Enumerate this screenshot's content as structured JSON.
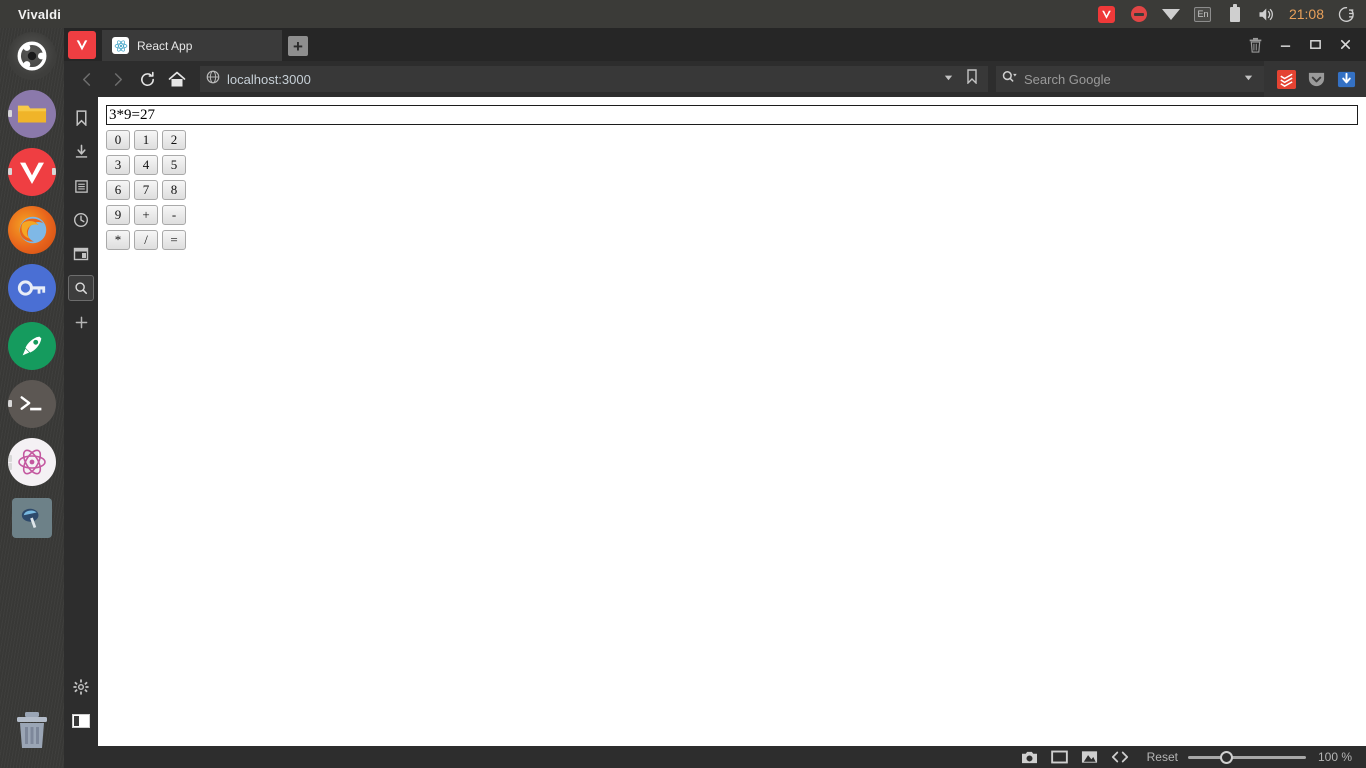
{
  "desktop": {
    "panel_title": "Vivaldi",
    "clock": "21:08",
    "tray": [
      {
        "name": "vivaldi-tray-icon",
        "label": "Vivaldi"
      },
      {
        "name": "do-not-disturb-icon",
        "label": "Do Not Disturb"
      },
      {
        "name": "wifi-icon",
        "label": "Network"
      },
      {
        "name": "keyboard-layout-icon",
        "label": "En"
      },
      {
        "name": "battery-icon",
        "label": "Battery"
      },
      {
        "name": "volume-icon",
        "label": "Volume"
      }
    ],
    "keyboard_layout": "En",
    "power_icon_label": "Session"
  },
  "launcher": {
    "items": [
      {
        "name": "launcher-item-ubuntu",
        "label": "Ubuntu",
        "color": "#3f3f3d"
      },
      {
        "name": "launcher-item-files",
        "label": "Files",
        "color": "#8b79ab"
      },
      {
        "name": "launcher-item-vivaldi",
        "label": "Vivaldi",
        "color": "#ef3e42"
      },
      {
        "name": "launcher-item-firefox",
        "label": "Firefox",
        "color": "#e8641c"
      },
      {
        "name": "launcher-item-passwords",
        "label": "Passwords and Keys",
        "color": "#4a6fd4"
      },
      {
        "name": "launcher-item-software",
        "label": "Ubuntu Software",
        "color": "#159b5e"
      },
      {
        "name": "launcher-item-terminal",
        "label": "Terminal",
        "color": "#5c5753"
      },
      {
        "name": "launcher-item-atom",
        "label": "Atom",
        "color": "#f4f1f4"
      },
      {
        "name": "launcher-item-screenshot",
        "label": "Screenshot",
        "color": "#6d8188"
      },
      {
        "name": "launcher-item-trash",
        "label": "Trash",
        "color": "#9aa5b5"
      }
    ]
  },
  "browser": {
    "menu_button_label": "Vivaldi Menu",
    "tabs": [
      {
        "title": "React App",
        "favicon": "react-logo-icon",
        "active": true
      }
    ],
    "newtab_label": "+",
    "window_controls": {
      "trash_label": "Closed Tabs",
      "minimize_label": "–",
      "maximize_label": "□",
      "close_label": "✕"
    },
    "navigation": {
      "back_label": "Back",
      "forward_label": "Forward",
      "reload_label": "Reload",
      "home_label": "Home"
    },
    "address": {
      "url": "localhost:3000",
      "page_icon": "globe-icon",
      "dropdown_label": "▾",
      "bookmark_label": "Bookmark"
    },
    "search": {
      "placeholder": "Search Google",
      "engine_icon": "search-engine-icon",
      "dropdown_label": "▾"
    },
    "extensions": [
      {
        "name": "extension-todoist",
        "label": "Todoist",
        "color": "#e44332"
      },
      {
        "name": "extension-pocket",
        "label": "Pocket",
        "color": "#8d8d8d"
      },
      {
        "name": "extension-download-manager",
        "label": "Download Manager",
        "color": "#3471c4"
      }
    ],
    "panel": {
      "items": [
        {
          "name": "panel-bookmarks",
          "icon": "bookmark-icon",
          "label": "Bookmarks",
          "active": false
        },
        {
          "name": "panel-downloads",
          "icon": "download-icon",
          "label": "Downloads",
          "active": false
        },
        {
          "name": "panel-notes",
          "icon": "notes-icon",
          "label": "Notes",
          "active": false
        },
        {
          "name": "panel-history",
          "icon": "clock-icon",
          "label": "History",
          "active": false
        },
        {
          "name": "panel-windows",
          "icon": "window-icon",
          "label": "Windows",
          "active": false
        },
        {
          "name": "panel-search",
          "icon": "search-icon",
          "label": "Search",
          "active": true
        },
        {
          "name": "panel-add",
          "icon": "plus-icon",
          "label": "Add Web Panel",
          "active": false
        }
      ],
      "settings_label": "Settings",
      "toggle_label": "Toggle Panel"
    },
    "statusbar": {
      "capture_label": "Capture Page",
      "tiling_label": "Page Tiling",
      "images_label": "Toggle Images",
      "devtools_label": "Developer Tools",
      "reset_label": "Reset",
      "zoom_level": "100 %",
      "zoom_value": 100
    }
  },
  "page": {
    "title": "React App",
    "calculator": {
      "display_value": "3*9=27",
      "rows": [
        [
          "0",
          "1",
          "2"
        ],
        [
          "3",
          "4",
          "5"
        ],
        [
          "6",
          "7",
          "8"
        ],
        [
          "9",
          "+",
          "-"
        ],
        [
          "*",
          "/",
          "="
        ]
      ]
    }
  }
}
